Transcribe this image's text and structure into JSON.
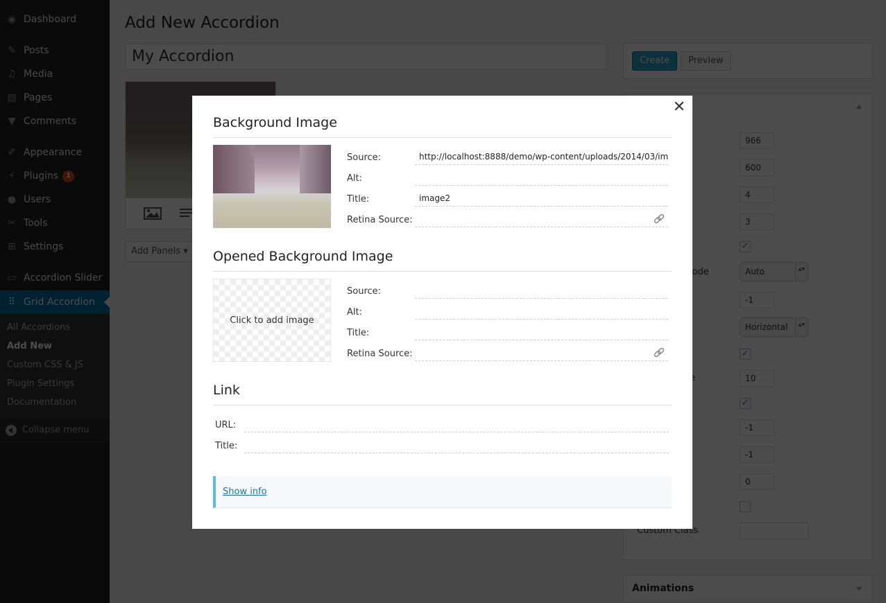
{
  "sidebar": {
    "items": [
      {
        "label": "Dashboard",
        "icon": "dashboard-icon",
        "glyph": "◉"
      },
      {
        "label": "Posts",
        "icon": "pin-icon",
        "glyph": "✎"
      },
      {
        "label": "Media",
        "icon": "media-icon",
        "glyph": "♫"
      },
      {
        "label": "Pages",
        "icon": "pages-icon",
        "glyph": "▤"
      },
      {
        "label": "Comments",
        "icon": "comment-icon",
        "glyph": "▼"
      },
      {
        "label": "Appearance",
        "icon": "brush-icon",
        "glyph": "✐"
      },
      {
        "label": "Plugins",
        "icon": "plugin-icon",
        "glyph": "⚡",
        "badge": "1"
      },
      {
        "label": "Users",
        "icon": "user-icon",
        "glyph": "●"
      },
      {
        "label": "Tools",
        "icon": "wrench-icon",
        "glyph": "✂"
      },
      {
        "label": "Settings",
        "icon": "settings-icon",
        "glyph": "⊞"
      },
      {
        "label": "Accordion Slider",
        "icon": "slider-icon",
        "glyph": "▭"
      },
      {
        "label": "Grid Accordion",
        "icon": "grid-icon",
        "glyph": "⠿"
      }
    ],
    "submenu": [
      "All Accordions",
      "Add New",
      "Custom CSS & JS",
      "Plugin Settings",
      "Documentation"
    ],
    "collapse_label": "Collapse menu"
  },
  "page": {
    "title": "Add New Accordion",
    "accordion_name": "My Accordion",
    "add_panels_label": "Add Panels ▾"
  },
  "publish": {
    "create_label": "Create",
    "preview_label": "Preview"
  },
  "settings": {
    "rows": [
      {
        "type": "input",
        "label": "",
        "value": "966"
      },
      {
        "type": "input",
        "label": "",
        "value": "600"
      },
      {
        "type": "input",
        "label": "",
        "value": "4"
      },
      {
        "type": "input",
        "label": "",
        "value": "3"
      },
      {
        "type": "check",
        "label": "",
        "checked": true
      },
      {
        "type": "select",
        "label": "lode",
        "value": "Auto"
      },
      {
        "type": "input",
        "label": "",
        "value": "-1"
      },
      {
        "type": "select",
        "label": "",
        "value": "Horizontal"
      },
      {
        "type": "check",
        "label": "",
        "checked": true
      },
      {
        "type": "input",
        "label": "e",
        "value": "10"
      },
      {
        "type": "check",
        "label": "",
        "checked": true
      },
      {
        "type": "input",
        "label": "",
        "value": "-1"
      },
      {
        "type": "input",
        "label": "",
        "value": "-1"
      },
      {
        "type": "input",
        "label": "",
        "value": "0"
      },
      {
        "type": "check",
        "label": "",
        "checked": false
      },
      {
        "type": "wide",
        "label": "Custom Class",
        "value": ""
      }
    ],
    "animations_label": "Animations"
  },
  "modal": {
    "close_label": "✕",
    "background": {
      "title": "Background Image",
      "fields": [
        {
          "label": "Source:",
          "value": "http://localhost:8888/demo/wp-content/uploads/2014/03/image"
        },
        {
          "label": "Alt:",
          "value": ""
        },
        {
          "label": "Title:",
          "value": "image2"
        },
        {
          "label": "Retina Source:",
          "value": ""
        }
      ]
    },
    "opened": {
      "title": "Opened Background Image",
      "placeholder": "Click to add image",
      "fields": [
        {
          "label": "Source:",
          "value": ""
        },
        {
          "label": "Alt:",
          "value": ""
        },
        {
          "label": "Title:",
          "value": ""
        },
        {
          "label": "Retina Source:",
          "value": ""
        }
      ]
    },
    "link": {
      "title": "Link",
      "fields": [
        {
          "label": "URL:",
          "value": ""
        },
        {
          "label": "Title:",
          "value": ""
        }
      ]
    },
    "show_info_label": "Show info"
  }
}
